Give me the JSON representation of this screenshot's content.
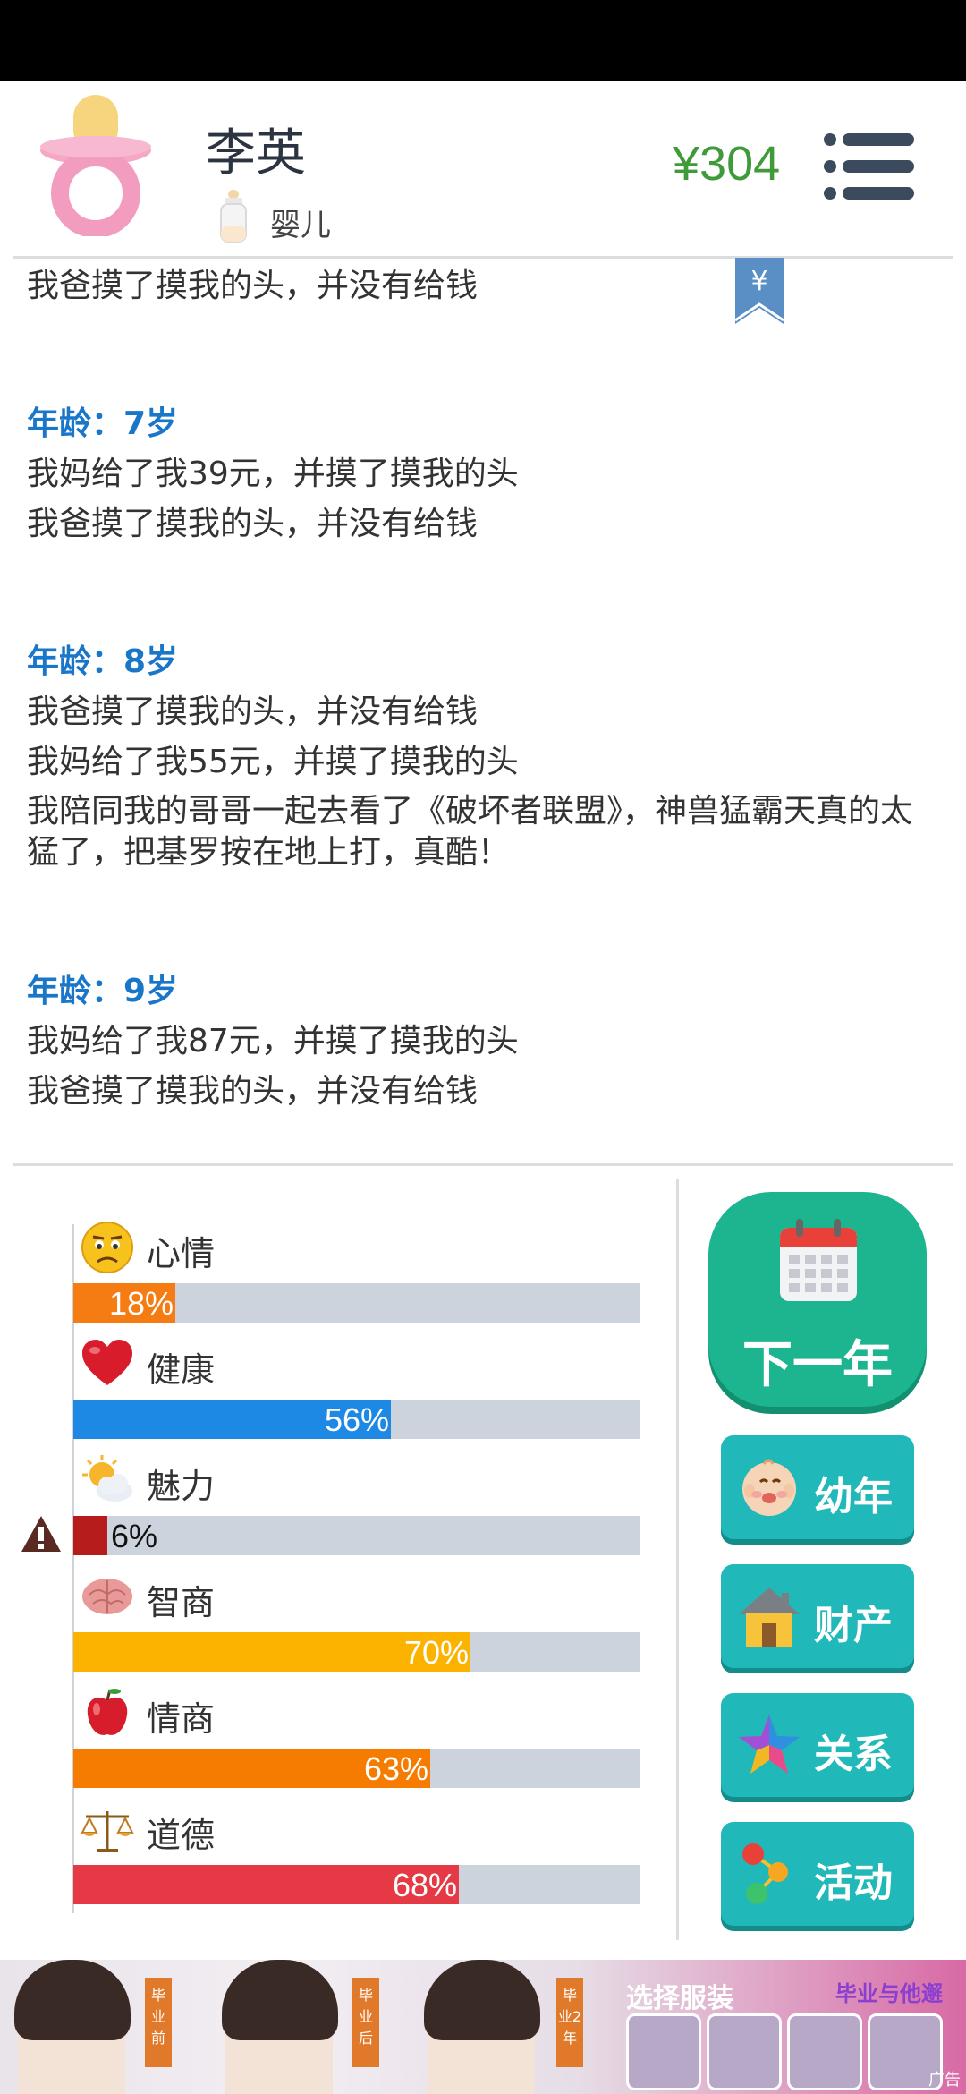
{
  "header": {
    "name": "李英",
    "stage": "婴儿",
    "money": "¥304",
    "avatar_icon": "pacifier-icon",
    "stage_icon": "baby-bottle-icon",
    "menu_icon": "menu-list-icon"
  },
  "bookmark": {
    "symbol": "¥"
  },
  "log": {
    "top_line": "我爸摸了摸我的头，并没有给钱",
    "entries": [
      {
        "age": "年龄：7岁",
        "lines": [
          "我妈给了我39元，并摸了摸我的头",
          "我爸摸了摸我的头，并没有给钱"
        ]
      },
      {
        "age": "年龄：8岁",
        "lines": [
          "我爸摸了摸我的头，并没有给钱",
          "我妈给了我55元，并摸了摸我的头"
        ],
        "wrapped": "我陪同我的哥哥一起去看了《破坏者联盟》，神兽猛霸天真的太猛了，把基罗按在地上打，真酷！"
      },
      {
        "age": "年龄：9岁",
        "lines": [
          "我妈给了我87元，并摸了摸我的头",
          "我爸摸了摸我的头，并没有给钱"
        ]
      }
    ]
  },
  "stats": [
    {
      "label": "心情",
      "pct_text": "18%",
      "value": 0.18,
      "color": "#f47c13",
      "icon": "sad-face-icon"
    },
    {
      "label": "健康",
      "pct_text": "56%",
      "value": 0.56,
      "color": "#1e88e5",
      "icon": "heart-icon"
    },
    {
      "label": "魅力",
      "pct_text": "6%",
      "value": 0.06,
      "color": "#b71c1c",
      "icon": "sun-cloud-icon"
    },
    {
      "label": "智商",
      "pct_text": "70%",
      "value": 0.7,
      "color": "#fbb300",
      "icon": "brain-icon"
    },
    {
      "label": "情商",
      "pct_text": "63%",
      "value": 0.63,
      "color": "#f57c00",
      "icon": "apple-icon"
    },
    {
      "label": "道德",
      "pct_text": "68%",
      "value": 0.68,
      "color": "#e53945",
      "icon": "scales-icon"
    }
  ],
  "actions": {
    "next_year": "下一年",
    "buttons": [
      {
        "label": "幼年",
        "icon": "baby-face-icon"
      },
      {
        "label": "财产",
        "icon": "house-icon"
      },
      {
        "label": "关系",
        "icon": "star-icon"
      },
      {
        "label": "活动",
        "icon": "activity-dots-icon"
      }
    ]
  },
  "ad": {
    "title": "选择服装",
    "subtitle": "毕业与他邂",
    "tags": [
      "毕业前",
      "毕业后",
      "毕业2年"
    ],
    "label": "广告"
  }
}
